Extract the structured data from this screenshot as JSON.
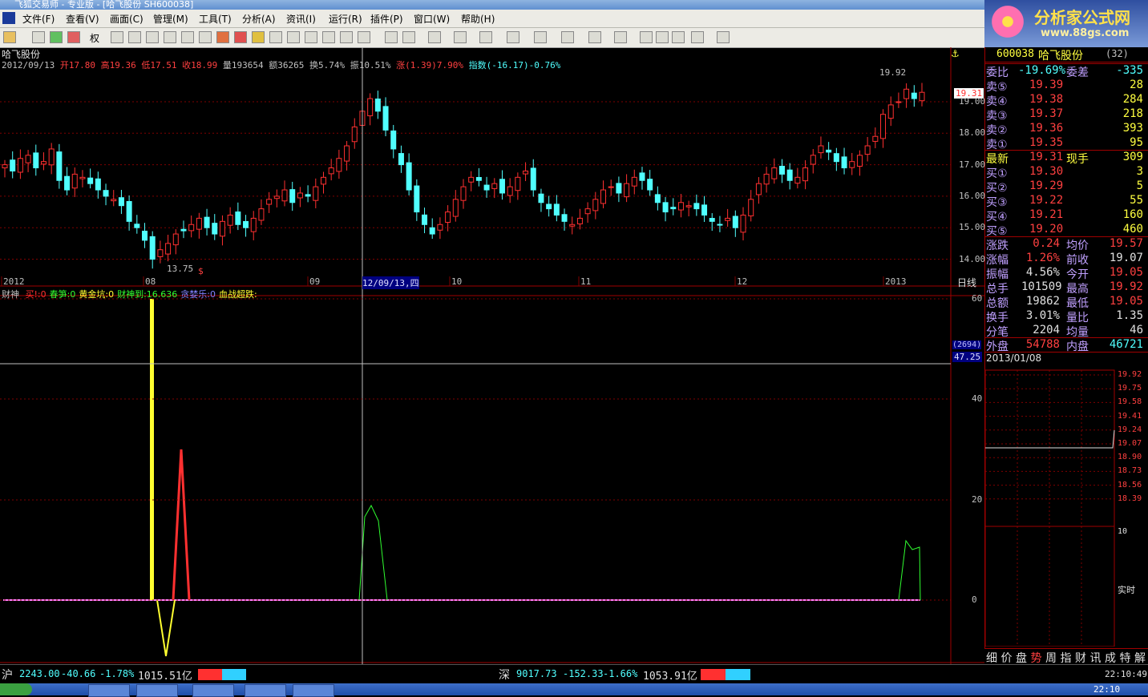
{
  "window": {
    "title": "飞狐交易师 - 专业版 - [哈飞股份 SH600038]"
  },
  "menu": [
    "文件(F)",
    "查看(V)",
    "画面(C)",
    "管理(M)",
    "工具(T)",
    "分析(A)",
    "资讯(I)",
    "运行(R)",
    "插件(P)",
    "窗口(W)",
    "帮助(H)"
  ],
  "toolbar": {
    "quan_label": "权"
  },
  "logo": {
    "title": "分析家公式网",
    "url": "www.88gs.com"
  },
  "kline": {
    "stock_name": "哈飞股份",
    "date": "2012/09/13",
    "info": [
      {
        "label": "开",
        "value": "17.80"
      },
      {
        "label": "高",
        "value": "19.36"
      },
      {
        "label": "低",
        "value": "17.51"
      },
      {
        "label": "收",
        "value": "18.99"
      },
      {
        "label": "量",
        "value": "193654"
      },
      {
        "label": "额",
        "value": "36265"
      },
      {
        "label": "换",
        "value": "5.74%"
      },
      {
        "label": "振",
        "value": "10.51%"
      }
    ],
    "change": "涨(1.39)7.90%",
    "index": "指数(-16.17)-0.76%",
    "high_label": "19.92",
    "low_label": "13.75",
    "cursor_price": "19.31",
    "y_ticks": [
      "19.00",
      "18.00",
      "17.00",
      "16.00",
      "15.00",
      "14.00"
    ],
    "y_values": [
      19,
      18,
      17,
      16,
      15,
      14
    ],
    "x_labels": [
      "2012",
      "08",
      "09",
      "12/09/13,四",
      "10",
      "11",
      "12",
      "2013"
    ],
    "period": "日线"
  },
  "indicator": {
    "name": "财神",
    "items": [
      {
        "label": "买!",
        "value": ":0",
        "color": "#ff3030"
      },
      {
        "label": "春笋",
        "value": ":0",
        "color": "#30ff30"
      },
      {
        "label": "黄金坑",
        "value": ":0",
        "color": "#ffff30"
      },
      {
        "label": "财神到",
        "value": ":16.636",
        "color": "#30ff30"
      },
      {
        "label": "贪婪乐",
        "value": ":0",
        "color": "#8080ff"
      },
      {
        "label": "血战超跌",
        "value": ":",
        "color": "#ffff30"
      }
    ],
    "y_ticks": [
      "60",
      "40",
      "20",
      "0"
    ],
    "cursor_value": "47.25",
    "cursor_count": "(2694)"
  },
  "quote": {
    "code": "600038",
    "name": "哈飞股份",
    "count": "(32)",
    "weibi_label": "委比",
    "weibi": "-19.69%",
    "weicha_label": "委差",
    "weicha": "-335",
    "asks": [
      {
        "label": "卖⑤",
        "price": "19.39",
        "vol": "28"
      },
      {
        "label": "卖④",
        "price": "19.38",
        "vol": "284"
      },
      {
        "label": "卖③",
        "price": "19.37",
        "vol": "218"
      },
      {
        "label": "卖②",
        "price": "19.36",
        "vol": "393"
      },
      {
        "label": "卖①",
        "price": "19.35",
        "vol": "95"
      }
    ],
    "last_label": "最新",
    "last": "19.31",
    "xianshou_label": "现手",
    "xianshou": "309",
    "bids": [
      {
        "label": "买①",
        "price": "19.30",
        "vol": "3"
      },
      {
        "label": "买②",
        "price": "19.29",
        "vol": "5"
      },
      {
        "label": "买③",
        "price": "19.22",
        "vol": "55"
      },
      {
        "label": "买④",
        "price": "19.21",
        "vol": "160"
      },
      {
        "label": "买⑤",
        "price": "19.20",
        "vol": "460"
      }
    ],
    "stats": [
      {
        "l1": "涨跌",
        "v1": "0.24",
        "c1": "#ff4040",
        "l2": "均价",
        "v2": "19.57",
        "c2": "#ff4040"
      },
      {
        "l1": "涨幅",
        "v1": "1.26%",
        "c1": "#ff4040",
        "l2": "前收",
        "v2": "19.07",
        "c2": "#e0e0e0"
      },
      {
        "l1": "振幅",
        "v1": "4.56%",
        "c1": "#e0e0e0",
        "l2": "今开",
        "v2": "19.05",
        "c2": "#ff4040"
      },
      {
        "l1": "总手",
        "v1": "101509",
        "c1": "#e0e0e0",
        "l2": "最高",
        "v2": "19.92",
        "c2": "#ff4040"
      },
      {
        "l1": "总额",
        "v1": "19862",
        "c1": "#e0e0e0",
        "l2": "最低",
        "v2": "19.05",
        "c2": "#ff4040"
      },
      {
        "l1": "换手",
        "v1": "3.01%",
        "c1": "#e0e0e0",
        "l2": "量比",
        "v2": "1.35",
        "c2": "#e0e0e0"
      },
      {
        "l1": "分笔",
        "v1": "2204",
        "c1": "#e0e0e0",
        "l2": "均量",
        "v2": "46",
        "c2": "#e0e0e0"
      }
    ],
    "waipan_label": "外盘",
    "waipan": "54788",
    "neipan_label": "内盘",
    "neipan": "46721",
    "mini_date": "2013/01/08",
    "mini_prices": [
      "19.92",
      "19.75",
      "19.58",
      "19.41",
      "19.24",
      "19.07",
      "18.90",
      "18.73",
      "18.56",
      "18.39"
    ],
    "mini_vol_max": "10",
    "mini_realtime": "实时",
    "tabs": [
      "细",
      "价",
      "盘",
      "势",
      "周",
      "指",
      "财",
      "讯",
      "成",
      "特",
      "解"
    ]
  },
  "status": {
    "sh_label": "沪",
    "sh_value": "2243.00",
    "sh_change": "-40.66",
    "sh_pct": "-1.78%",
    "sh_amount": "1015.51亿",
    "sz_label": "深",
    "sz_value": "9017.73",
    "sz_change": "-152.33",
    "sz_pct": "-1.66%",
    "sz_amount": "1053.91亿",
    "time": "22:10:49"
  },
  "taskbar": {
    "clock": "22:10"
  },
  "colors": {
    "up": "#ff3030",
    "down": "#50ffff",
    "grid": "#800000",
    "bg": "#000000"
  }
}
